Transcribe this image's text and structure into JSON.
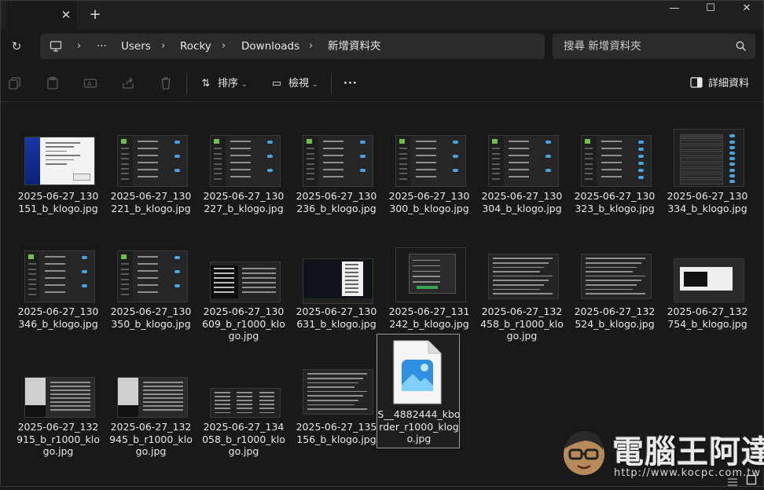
{
  "window": {
    "tab_close": "✕",
    "new_tab": "+",
    "minimize": "—",
    "maximize": "☐",
    "close": "✕"
  },
  "address": {
    "crumbs": [
      "Users",
      "Rocky",
      "Downloads",
      "新增資料夾"
    ],
    "ellipsis": "···",
    "search_placeholder": "搜尋 新增資料夾"
  },
  "toolbar": {
    "sort_label": "排序",
    "view_label": "檢視",
    "more_label": "···",
    "details_label": "詳細資料"
  },
  "files": [
    {
      "name": "2025-06-27_130151_b_klogo.jpg",
      "thumb": "installer"
    },
    {
      "name": "2025-06-27_130221_b_klogo.jpg",
      "thumb": "settings"
    },
    {
      "name": "2025-06-27_130227_b_klogo.jpg",
      "thumb": "settings"
    },
    {
      "name": "2025-06-27_130236_b_klogo.jpg",
      "thumb": "settings"
    },
    {
      "name": "2025-06-27_130300_b_klogo.jpg",
      "thumb": "settings"
    },
    {
      "name": "2025-06-27_130304_b_klogo.jpg",
      "thumb": "settings"
    },
    {
      "name": "2025-06-27_130323_b_klogo.jpg",
      "thumb": "toggles"
    },
    {
      "name": "2025-06-27_130334_b_klogo.jpg",
      "thumb": "menu-tall"
    },
    {
      "name": "2025-06-27_130346_b_klogo.jpg",
      "thumb": "settings"
    },
    {
      "name": "2025-06-27_130350_b_klogo.jpg",
      "thumb": "settings"
    },
    {
      "name": "2025-06-27_130609_b_r1000_klogo.jpg",
      "thumb": "article-dark"
    },
    {
      "name": "2025-06-27_130631_b_klogo.jpg",
      "thumb": "popup"
    },
    {
      "name": "2025-06-27_131242_b_klogo.jpg",
      "thumb": "dialog"
    },
    {
      "name": "2025-06-27_132458_b_r1000_klogo.jpg",
      "thumb": "article"
    },
    {
      "name": "2025-06-27_132524_b_klogo.jpg",
      "thumb": "article"
    },
    {
      "name": "2025-06-27_132754_b_klogo.jpg",
      "thumb": "window"
    },
    {
      "name": "2025-06-27_132915_b_r1000_klogo.jpg",
      "thumb": "article-light"
    },
    {
      "name": "2025-06-27_132945_b_r1000_klogo.jpg",
      "thumb": "article-light"
    },
    {
      "name": "2025-06-27_134058_b_r1000_klogo.jpg",
      "thumb": "list-wide"
    },
    {
      "name": "2025-06-27_135156_b_klogo.jpg",
      "thumb": "article"
    },
    {
      "name": "S__4882444_kborder_r1000_klogo.jpg",
      "thumb": "file-icon"
    }
  ],
  "watermark": {
    "title": "電腦王阿達",
    "url": "http://www.kocpc.com.tw"
  },
  "colors": {
    "accent": "#4aa3df",
    "background": "#191919",
    "panel": "#2b2b2b"
  }
}
